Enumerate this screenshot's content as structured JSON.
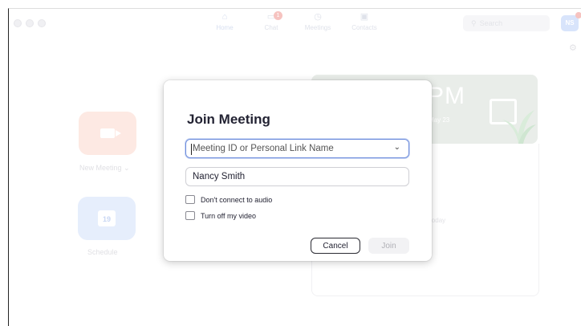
{
  "nav": {
    "items": [
      {
        "label": "Home",
        "icon": "home-icon"
      },
      {
        "label": "Chat",
        "icon": "chat-icon",
        "badge": "1"
      },
      {
        "label": "Meetings",
        "icon": "clock-icon"
      },
      {
        "label": "Contacts",
        "icon": "contacts-icon"
      }
    ],
    "search_placeholder": "Search",
    "avatar_initials": "NS"
  },
  "home": {
    "new_meeting_label": "New Meeting ⌄",
    "schedule_label": "Schedule",
    "calendar_day": "19",
    "clock_time": "PM",
    "clock_date": "May 23",
    "no_meetings_text": "etings today"
  },
  "dialog": {
    "title": "Join Meeting",
    "meeting_id_placeholder": "Meeting ID or Personal Link Name",
    "name_value": "Nancy Smith",
    "option_audio": "Don't connect to audio",
    "option_video": "Turn off my video",
    "cancel_label": "Cancel",
    "join_label": "Join"
  },
  "colors": {
    "accent": "#6e8ddc",
    "new_meeting_tile": "#fde9e3",
    "schedule_tile": "#e6eefc",
    "badge": "#f6c3c0"
  }
}
